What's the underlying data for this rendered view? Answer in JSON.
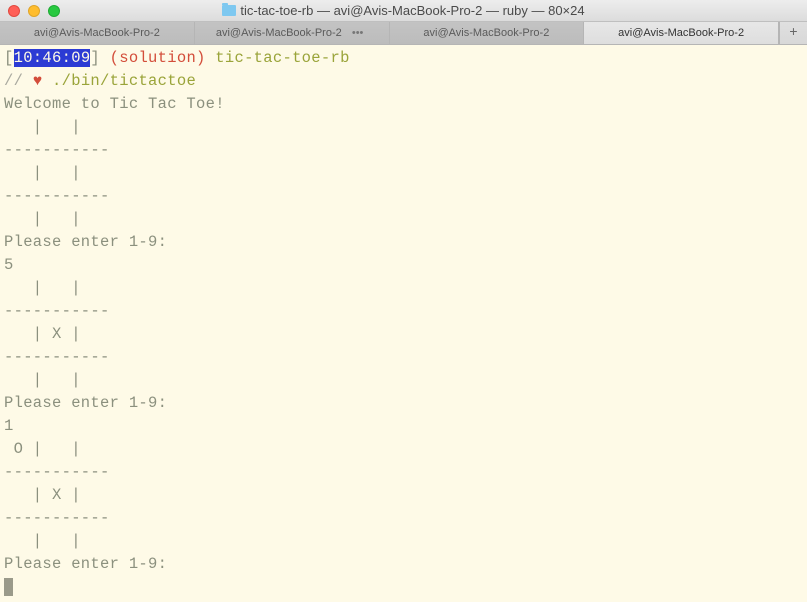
{
  "window": {
    "title": "tic-tac-toe-rb — avi@Avis-MacBook-Pro-2 — ruby — 80×24"
  },
  "tabs": {
    "items": [
      {
        "label": "avi@Avis-MacBook-Pro-2",
        "active": false,
        "ellipsis": false
      },
      {
        "label": "avi@Avis-MacBook-Pro-2",
        "active": false,
        "ellipsis": true
      },
      {
        "label": "avi@Avis-MacBook-Pro-2",
        "active": false,
        "ellipsis": false
      },
      {
        "label": "avi@Avis-MacBook-Pro-2",
        "active": true,
        "ellipsis": false
      }
    ],
    "new_tab": "+"
  },
  "prompt": {
    "lbracket": "[",
    "time": "10:46:09",
    "rbracket": "]",
    "branch": "(solution)",
    "dir": "tic-tac-toe-rb"
  },
  "command": {
    "slashes": "//",
    "heart": "♥",
    "text": "./bin/tictactoe"
  },
  "output": {
    "lines": [
      "Welcome to Tic Tac Toe!",
      "   |   |   ",
      "-----------",
      "   |   |   ",
      "-----------",
      "   |   |   ",
      "Please enter 1-9:",
      "5",
      "   |   |   ",
      "-----------",
      "   | X |   ",
      "-----------",
      "   |   |   ",
      "Please enter 1-9:",
      "1",
      " O |   |   ",
      "-----------",
      "   | X |   ",
      "-----------",
      "   |   |   ",
      "Please enter 1-9:"
    ]
  }
}
